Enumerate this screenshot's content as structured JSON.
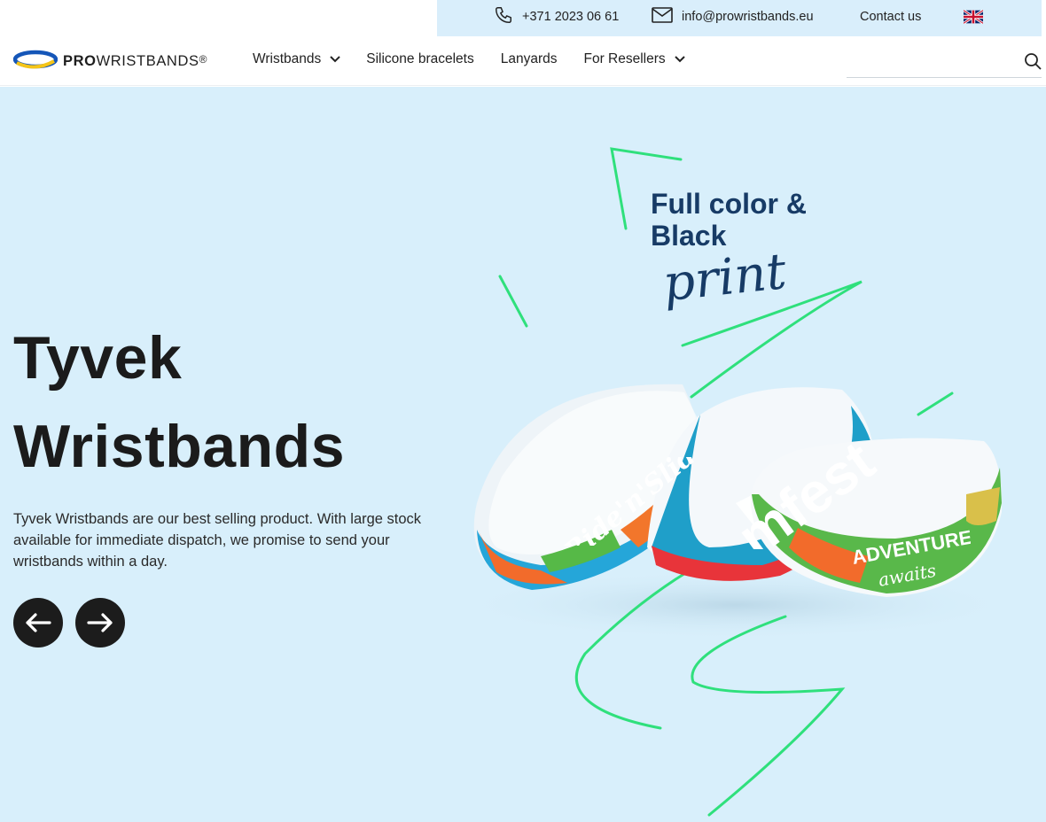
{
  "topbar": {
    "phone": "+371 2023 06 61",
    "email": "info@prowristbands.eu",
    "contact": "Contact us",
    "language_icon": "uk-flag-icon"
  },
  "header": {
    "logo": {
      "pro": "PRO",
      "rest": "WRISTBANDS",
      "reg": "®"
    },
    "nav": {
      "wristbands": "Wristbands",
      "silicone": "Silicone bracelets",
      "lanyards": "Lanyards",
      "resellers": "For Resellers"
    },
    "search": {
      "placeholder": "",
      "icon": "search-icon"
    }
  },
  "hero": {
    "title_line1": "Tyvek",
    "title_line2": "Wristbands",
    "description": "Tyvek Wristbands are our best selling product. With large stock available for immediate dispatch, we promise to send your wristbands within a day.",
    "promo_line1": "Full color &",
    "promo_line2": "Black",
    "promo_script": "print",
    "band1_text": "Ride'n'Slide",
    "band2_text": "mfest",
    "band3_line1": "ADVENTURE",
    "band3_line2": "awaits",
    "prev_icon": "arrow-left-icon",
    "next_icon": "arrow-right-icon"
  },
  "colors": {
    "hero_bg": "#d8effb",
    "topbar_bg": "#d9eefb",
    "accent_green": "#2fe07c",
    "promo_navy": "#173b66",
    "dark": "#1c1c1c"
  }
}
